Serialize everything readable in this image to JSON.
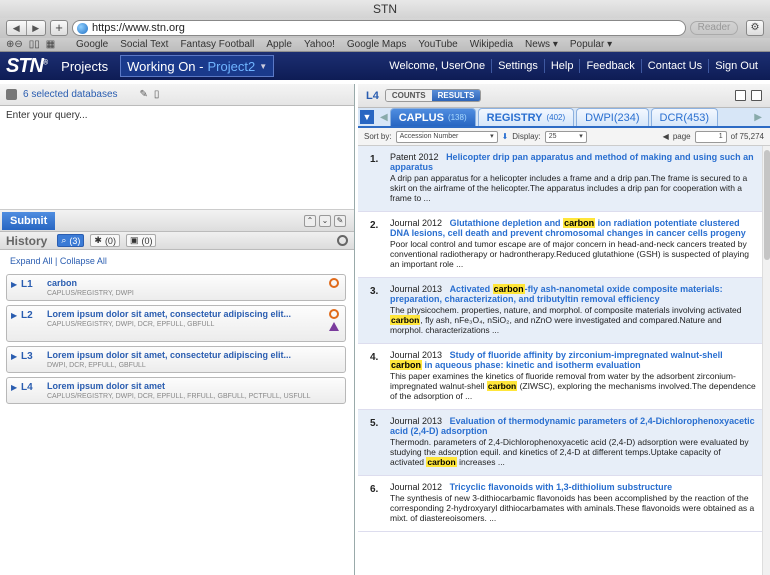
{
  "browser": {
    "window_title": "STN",
    "url": "https://www.stn.org",
    "reader_label": "Reader",
    "bookmarks": [
      "Google",
      "Social Text",
      "Fantasy Football",
      "Apple",
      "Yahoo!",
      "Google Maps",
      "YouTube",
      "Wikipedia",
      "News ▾",
      "Popular ▾"
    ]
  },
  "app": {
    "logo": "STN",
    "projects_label": "Projects",
    "working_on_label": "Working On -",
    "project_name": "Project2",
    "welcome": "Welcome, UserOne",
    "nav": [
      "Settings",
      "Help",
      "Feedback",
      "Contact Us",
      "Sign Out"
    ]
  },
  "left": {
    "selected_databases": "6 selected databases",
    "query_placeholder": "Enter your query...",
    "submit_label": "Submit",
    "history_title": "History",
    "filters": [
      {
        "icon": "search-icon",
        "count": "(3)"
      },
      {
        "icon": "bookmark-icon",
        "count": "(0)"
      },
      {
        "icon": "save-icon",
        "count": "(0)"
      }
    ],
    "expand_all": "Expand All",
    "collapse_all": "Collapse All",
    "history": [
      {
        "id": "L1",
        "query": "carbon",
        "dbs": "CAPLUS/REGISTRY, DWPI",
        "icons": [
          "clock-icon"
        ]
      },
      {
        "id": "L2",
        "query": "Lorem ipsum dolor sit amet, consectetur adipiscing elit...",
        "dbs": "CAPLUS/REGISTRY, DWPI, DCR, EPFULL, GBFULL",
        "icons": [
          "clock-icon",
          "warning-icon"
        ]
      },
      {
        "id": "L3",
        "query": "Lorem ipsum dolor sit amet, consectetur adipiscing elit...",
        "dbs": "DWPI, DCR, EPFULL, GBFULL",
        "icons": []
      },
      {
        "id": "L4",
        "query": "Lorem ipsum dolor sit amet",
        "dbs": "CAPLUS/REGISTRY, DWPI, DCR, EPFULL, FRFULL, GBFULL, PCTFULL, USFULL",
        "icons": []
      }
    ]
  },
  "right": {
    "set_label": "L4",
    "counts_label": "COUNTS",
    "results_label": "RESULTS",
    "tabs": [
      {
        "name": "CAPLUS",
        "count": "(138)",
        "active": true
      },
      {
        "name": "REGISTRY",
        "count": "(402)",
        "active": false
      },
      {
        "name": "DWPI(234)",
        "count": "",
        "active": false
      },
      {
        "name": "DCR(453)",
        "count": "",
        "active": false
      }
    ],
    "sort_by_label": "Sort by:",
    "sort_by_value": "Accession Number",
    "display_label": "Display:",
    "display_value": "25",
    "page_label": "page",
    "page_value": "1",
    "page_total": "of 75,274",
    "results": [
      {
        "num": "1.",
        "meta": "Patent 2012",
        "title": "Helicopter drip pan apparatus and method of making and using such an apparatus",
        "abstract": "A drip pan apparatus for a helicopter includes a frame and a drip pan.The frame is secured to a skirt on the airframe of the helicopter.The apparatus includes a drip pan for cooperation with a frame to ..."
      },
      {
        "num": "2.",
        "meta": "Journal 2012",
        "title_pre": "Glutathione depletion and ",
        "title_hl": "carbon",
        "title_post": " ion radiation potentiate clustered DNA lesions, cell death and prevent chromosomal changes in cancer cells progeny",
        "abstract": "Poor local control and tumor escape are of major concern in head-and-neck cancers treated by conventional radiotherapy or hadrontherapy.Reduced glutathione (GSH) is suspected of playing an important role ..."
      },
      {
        "num": "3.",
        "meta": "Journal 2013",
        "title_pre": "Activated ",
        "title_hl": "carbon",
        "title_post": "-fly ash-nanometal oxide composite materials: preparation, characterization, and tributyltin removal efficiency",
        "abs_pre": "The physicochem. properties, nature, and morphol. of composite materials involving activated ",
        "abs_hl": "carbon",
        "abs_post": ", fly ash, nFe₃O₄, nSiO₂, and nZnO were investigated and compared.Nature and morphol. characterizations ..."
      },
      {
        "num": "4.",
        "meta": "Journal 2013",
        "title_pre": "Study of fluoride affinity by zirconium-impregnated walnut-shell ",
        "title_hl": "carbon",
        "title_post": " in aqueous phase: kinetic and isotherm evaluation",
        "abs_pre": "This paper examines the kinetics of fluoride removal from water by the adsorbent zirconium-impregnated walnut-shell ",
        "abs_hl": "carbon",
        "abs_post": " (ZIWSC), exploring the mechanisms involved.The dependence of the adsorption of ..."
      },
      {
        "num": "5.",
        "meta": "Journal 2013",
        "title": "Evaluation of thermodynamic parameters of 2,4-Dichlorophenoxyacetic acid (2,4-D) adsorption",
        "abs_pre": "Thermodn. parameters of 2,4-Dichlorophenoxyacetic acid (2,4-D) adsorption were evaluated by studying the adsorption equil. and kinetics of 2,4-D at different temps.Uptake capacity of activated ",
        "abs_hl": "carbon",
        "abs_post": " increases ..."
      },
      {
        "num": "6.",
        "meta": "Journal 2012",
        "title": "Tricyclic flavonoids with 1,3-dithiolium substructure",
        "abstract": "The synthesis of new 3-dithiocarbamic flavonoids has been accomplished by the reaction of the corresponding 2-hydroxyaryl dithiocarbamates with aminals.These flavonoids were obtained as a mixt. of diastereoisomers. ..."
      }
    ]
  }
}
